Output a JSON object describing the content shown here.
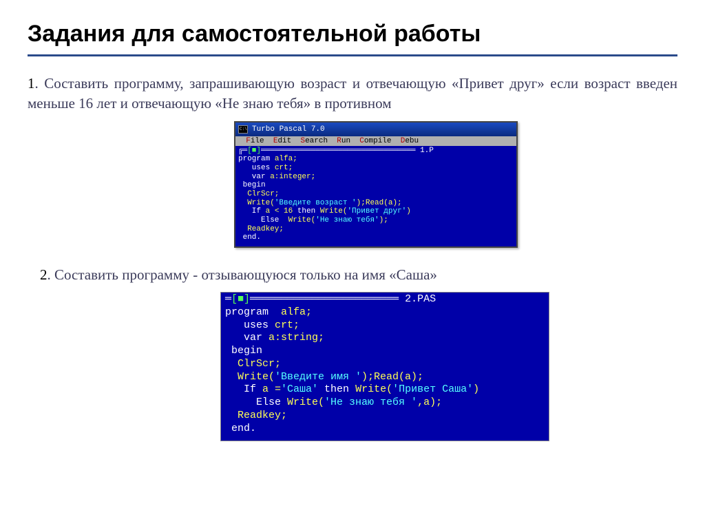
{
  "title": "Задания для самостоятельной работы",
  "task1": {
    "num": "1",
    "text_line1": ". Составить программу, запрашивающую возраст и отвечающую «Привет друг» если возраст введен меньше 16 лет и отвечающую «Не знаю тебя» в противном"
  },
  "task2": {
    "num": "2",
    "text": ". Составить  программу  -  отзывающуюся  только  на  имя «Саша»"
  },
  "tp1": {
    "title": "Turbo Pascal 7.0",
    "menu": {
      "file": "ile",
      "edit": "dit",
      "search": "earch",
      "run": "un",
      "compile": "ompile",
      "debug": "ebu"
    },
    "topline_file": "1.P",
    "code": {
      "l1a": "program",
      "l1b": " alfa;",
      "l2a": "   uses",
      "l2b": " crt;",
      "l3a": "   var",
      "l3b": " a:integer;",
      "l4": " begin",
      "l5": "  ClrScr;",
      "l6a": "  Write(",
      "l6s": "'Введите возpaст '",
      "l6b": ");Read(a);",
      "l7a": "   If",
      "l7b": " a < 16 ",
      "l7c": "then",
      "l7d": " Write(",
      "l7s": "'Пpивет дpуг'",
      "l7e": ")",
      "l8a": "     Else  ",
      "l8b": "Write(",
      "l8s": "'He знаю тебя'",
      "l8c": ");",
      "l9": "  Readkey;",
      "l10": " end."
    }
  },
  "tp2": {
    "topline_file": "2.PAS",
    "code": {
      "l1a": "program",
      "l1b": "  alfa;",
      "l2a": "   uses",
      "l2b": " crt;",
      "l3a": "   var",
      "l3b": " a:string;",
      "l4": " begin",
      "l5": "  ClrScr;",
      "l6a": "  Write(",
      "l6s": "'Введите имя '",
      "l6b": ");Read(a);",
      "l7a": "   If",
      "l7b": " a =",
      "l7s1": "'Caшa'",
      "l7c": " then",
      "l7d": " Write(",
      "l7s2": "'Пpивет Caшa'",
      "l7e": ")",
      "l8a": "     Else ",
      "l8b": "Write(",
      "l8s": "'He знаю тебя '",
      "l8c": ",a);",
      "l9": "  Readkey;",
      "l10": " end."
    }
  }
}
